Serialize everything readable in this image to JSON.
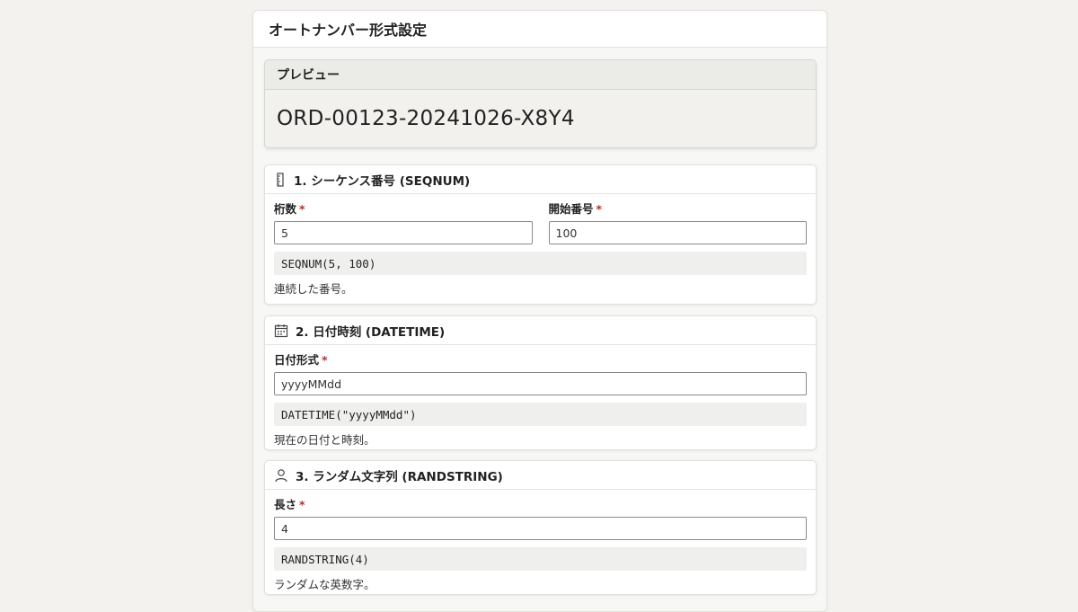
{
  "panel": {
    "title": "オートナンバー形式設定"
  },
  "preview": {
    "title": "プレビュー",
    "value": "ORD-00123-20241026-X8Y4"
  },
  "sections": {
    "seqnum": {
      "title": "1. シーケンス番号 (SEQNUM)",
      "icon": "ruler-icon",
      "fields": {
        "digits": {
          "label": "桁数",
          "value": "5"
        },
        "start": {
          "label": "開始番号",
          "value": "100"
        }
      },
      "formula": "SEQNUM(5, 100)",
      "description": "連続した番号。"
    },
    "datetime": {
      "title": "2. 日付時刻 (DATETIME)",
      "icon": "calendar-icon",
      "fields": {
        "format": {
          "label": "日付形式",
          "value": "yyyyMMdd"
        }
      },
      "formula": "DATETIME(\"yyyyMMdd\")",
      "description": "現在の日付と時刻。"
    },
    "randstring": {
      "title": "3. ランダム文字列 (RANDSTRING)",
      "icon": "person-icon",
      "fields": {
        "length": {
          "label": "長さ",
          "value": "4"
        }
      },
      "formula": "RANDSTRING(4)",
      "description": "ランダムな英数字。"
    }
  },
  "required_marker": "*"
}
